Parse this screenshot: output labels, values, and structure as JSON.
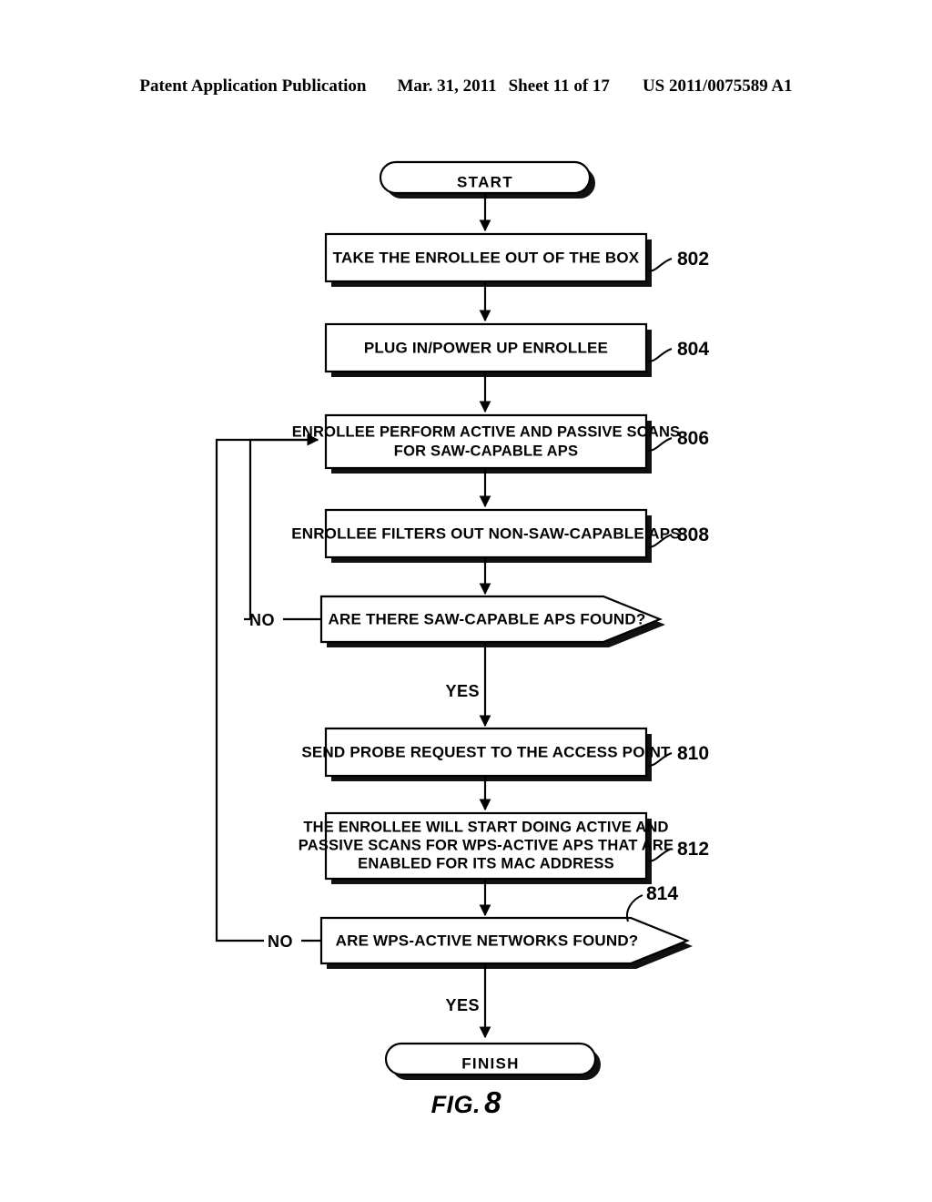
{
  "header": {
    "publication": "Patent Application Publication",
    "date": "Mar. 31, 2011",
    "sheet": "Sheet 11 of 17",
    "patent_number": "US 2011/0075589 A1"
  },
  "figure": {
    "label": "FIG.",
    "number": "8"
  },
  "flowchart": {
    "start": {
      "label": "START"
    },
    "finish": {
      "label": "FINISH"
    },
    "steps": [
      {
        "ref": "802",
        "lines": [
          "TAKE THE ENROLLEE OUT OF THE BOX"
        ]
      },
      {
        "ref": "804",
        "lines": [
          "PLUG IN/POWER UP ENROLLEE"
        ]
      },
      {
        "ref": "806",
        "lines": [
          "ENROLLEE PERFORM ACTIVE AND PASSIVE SCANS",
          "FOR SAW-CAPABLE APS"
        ]
      },
      {
        "ref": "808",
        "lines": [
          "ENROLLEE FILTERS OUT NON-SAW-CAPABLE APS"
        ]
      },
      {
        "ref": "810",
        "lines": [
          "SEND PROBE REQUEST TO THE ACCESS POINT"
        ]
      },
      {
        "ref": "812",
        "lines": [
          "THE ENROLLEE WILL START DOING ACTIVE AND",
          "PASSIVE SCANS FOR WPS-ACTIVE APS THAT ARE",
          "ENABLED FOR ITS MAC ADDRESS"
        ]
      }
    ],
    "decisions": [
      {
        "ref": "",
        "label": "ARE THERE SAW-CAPABLE APS FOUND?",
        "no_label": "NO",
        "yes_label": "YES"
      },
      {
        "ref": "814",
        "label": "ARE WPS-ACTIVE NETWORKS FOUND?",
        "no_label": "NO",
        "yes_label": "YES"
      }
    ]
  },
  "colors": {
    "ink": "#000000",
    "paper": "#ffffff"
  }
}
